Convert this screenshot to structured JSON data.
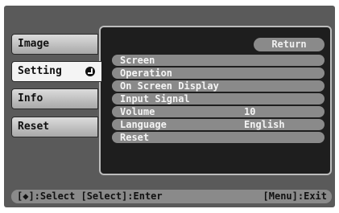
{
  "tabs": [
    {
      "label": "Image"
    },
    {
      "label": "Setting"
    },
    {
      "label": "Info"
    },
    {
      "label": "Reset"
    }
  ],
  "panel": {
    "return_label": "Return",
    "items": [
      {
        "label": "Screen",
        "value": ""
      },
      {
        "label": "Operation",
        "value": ""
      },
      {
        "label": "On Screen Display",
        "value": ""
      },
      {
        "label": "Input Signal",
        "value": ""
      },
      {
        "label": "Volume",
        "value": "10"
      },
      {
        "label": "Language",
        "value": "English"
      },
      {
        "label": "Reset",
        "value": ""
      }
    ]
  },
  "help": {
    "left": "[◆]:Select [Select]:Enter",
    "right": "[Menu]:Exit"
  }
}
